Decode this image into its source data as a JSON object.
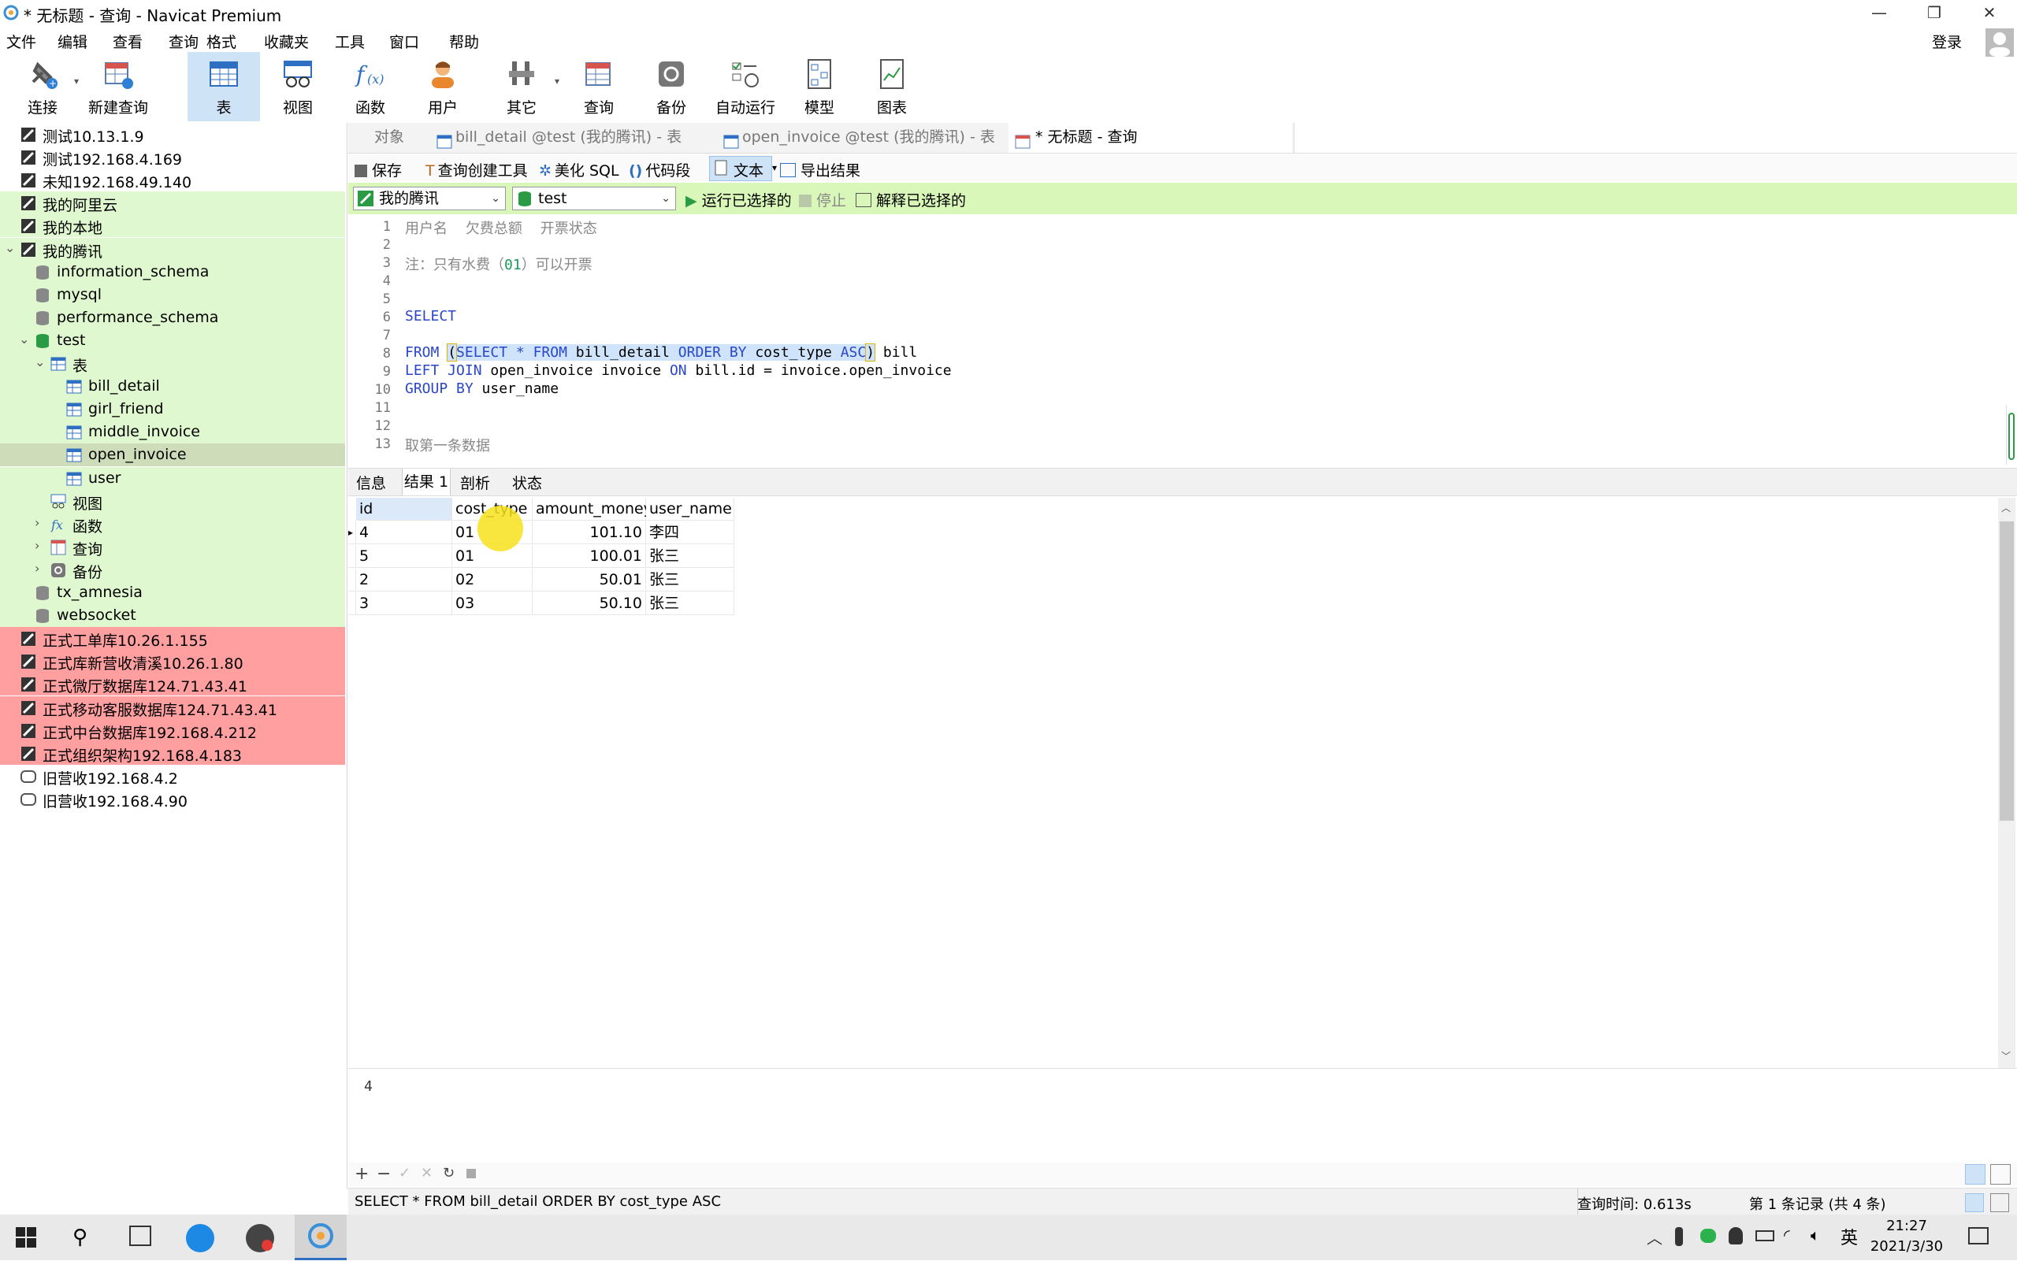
{
  "window": {
    "title": "* 无标题 - 查询 - Navicat Premium",
    "controls": [
      "—",
      "❐",
      "✕"
    ]
  },
  "menu": [
    "文件",
    "编辑",
    "查看",
    "查询",
    "格式",
    "收藏夹",
    "工具",
    "窗口",
    "帮助"
  ],
  "login": "登录",
  "toolbar": [
    {
      "label": "连接",
      "icon": "plug-icon"
    },
    {
      "label": "新建查询",
      "icon": "new-query-icon"
    },
    {
      "label": "表",
      "icon": "table-icon",
      "active": true
    },
    {
      "label": "视图",
      "icon": "view-icon"
    },
    {
      "label": "函数",
      "icon": "function-icon"
    },
    {
      "label": "用户",
      "icon": "user-icon"
    },
    {
      "label": "其它",
      "icon": "tools-icon"
    },
    {
      "label": "查询",
      "icon": "query-icon"
    },
    {
      "label": "备份",
      "icon": "backup-icon"
    },
    {
      "label": "自动运行",
      "icon": "autorun-icon"
    },
    {
      "label": "模型",
      "icon": "model-icon"
    },
    {
      "label": "图表",
      "icon": "chart-icon"
    }
  ],
  "tree": [
    {
      "label": "测试10.13.1.9",
      "bg": "",
      "type": "conn"
    },
    {
      "label": "测试192.168.4.169",
      "bg": "",
      "type": "conn"
    },
    {
      "label": "未知192.168.49.140",
      "bg": "",
      "type": "conn"
    },
    {
      "label": "我的阿里云",
      "bg": "g",
      "type": "conn"
    },
    {
      "label": "我的本地",
      "bg": "g",
      "type": "conn"
    },
    {
      "label": "我的腾讯",
      "bg": "g",
      "type": "conn-open"
    },
    {
      "label": "information_schema",
      "bg": "g",
      "type": "db"
    },
    {
      "label": "mysql",
      "bg": "g",
      "type": "db"
    },
    {
      "label": "performance_schema",
      "bg": "g",
      "type": "db"
    },
    {
      "label": "test",
      "bg": "g",
      "type": "db-open"
    },
    {
      "label": "表",
      "bg": "g",
      "type": "folder-table"
    },
    {
      "label": "bill_detail",
      "bg": "g",
      "type": "table"
    },
    {
      "label": "girl_friend",
      "bg": "g",
      "type": "table"
    },
    {
      "label": "middle_invoice",
      "bg": "g",
      "type": "table"
    },
    {
      "label": "open_invoice",
      "bg": "sel",
      "type": "table"
    },
    {
      "label": "user",
      "bg": "g",
      "type": "table"
    },
    {
      "label": "视图",
      "bg": "g",
      "type": "folder-view"
    },
    {
      "label": "函数",
      "bg": "g",
      "type": "folder-func"
    },
    {
      "label": "查询",
      "bg": "g",
      "type": "folder-query"
    },
    {
      "label": "备份",
      "bg": "g",
      "type": "folder-backup"
    },
    {
      "label": "tx_amnesia",
      "bg": "g",
      "type": "db"
    },
    {
      "label": "websocket",
      "bg": "g",
      "type": "db"
    },
    {
      "label": "正式工单库10.26.1.155",
      "bg": "r",
      "type": "conn"
    },
    {
      "label": "正式库新营收清溪10.26.1.80",
      "bg": "r",
      "type": "conn"
    },
    {
      "label": "正式微厅数据库124.71.43.41",
      "bg": "r",
      "type": "conn"
    },
    {
      "label": "正式移动客服数据库124.71.43.41",
      "bg": "r",
      "type": "conn"
    },
    {
      "label": "正式中台数据库192.168.4.212",
      "bg": "r",
      "type": "conn"
    },
    {
      "label": "正式组织架构192.168.4.183",
      "bg": "r",
      "type": "conn"
    },
    {
      "label": "旧营收192.168.4.2",
      "bg": "",
      "type": "conn-grey"
    },
    {
      "label": "旧营收192.168.4.90",
      "bg": "",
      "type": "conn-grey"
    }
  ],
  "tabs": [
    "对象",
    "bill_detail @test (我的腾讯) - 表",
    "open_invoice @test (我的腾讯) - 表",
    "* 无标题 - 查询"
  ],
  "qtools": [
    "保存",
    "查询创建工具",
    "美化 SQL",
    "代码段",
    "文本",
    "导出结果"
  ],
  "runbar": {
    "connection": "我的腾讯",
    "database": "test",
    "run": "运行已选择的",
    "stop": "停止",
    "explain": "解释已选择的"
  },
  "editor_lines": [
    {
      "n": "1",
      "segments": [
        {
          "t": "用户名    欠费总额    开票状态",
          "c": "cm"
        }
      ]
    },
    {
      "n": "2",
      "segments": []
    },
    {
      "n": "3",
      "segments": [
        {
          "t": "注：只有水费（",
          "c": "cm"
        },
        {
          "t": "01",
          "c": "num"
        },
        {
          "t": "）可以开票",
          "c": "cm"
        }
      ]
    },
    {
      "n": "4",
      "segments": []
    },
    {
      "n": "5",
      "segments": []
    },
    {
      "n": "6",
      "segments": [
        {
          "t": "SELECT",
          "c": "kw"
        }
      ]
    },
    {
      "n": "7",
      "segments": []
    },
    {
      "n": "8",
      "segments": [
        {
          "t": "FROM ",
          "c": "kw"
        },
        {
          "t": "(",
          "c": "hlp"
        },
        {
          "t": "SELECT * FROM ",
          "c": "kwhl"
        },
        {
          "t": "bill_detail ",
          "c": "hl"
        },
        {
          "t": "ORDER BY ",
          "c": "kwhl"
        },
        {
          "t": "cost_type ",
          "c": "hl"
        },
        {
          "t": "ASC",
          "c": "kwhl"
        },
        {
          "t": ")",
          "c": "hlp"
        },
        {
          "t": " bill",
          "c": ""
        }
      ]
    },
    {
      "n": "9",
      "segments": [
        {
          "t": "LEFT JOIN ",
          "c": "kw"
        },
        {
          "t": "open_invoice invoice ",
          "c": ""
        },
        {
          "t": "ON ",
          "c": "kw"
        },
        {
          "t": "bill.id = invoice.open_invoice",
          "c": ""
        }
      ]
    },
    {
      "n": "10",
      "segments": [
        {
          "t": "GROUP BY ",
          "c": "kw"
        },
        {
          "t": "user_name",
          "c": ""
        }
      ]
    },
    {
      "n": "11",
      "segments": []
    },
    {
      "n": "12",
      "segments": []
    },
    {
      "n": "13",
      "segments": [
        {
          "t": "取第一条数据",
          "c": "cm"
        }
      ]
    }
  ],
  "result_tabs": [
    "信息",
    "结果 1",
    "剖析",
    "状态"
  ],
  "grid": {
    "columns": [
      "id",
      "cost_type",
      "amount_money",
      "user_name"
    ],
    "rows": [
      [
        "4",
        "01",
        "101.10",
        "李四"
      ],
      [
        "5",
        "01",
        "100.01",
        "张三"
      ],
      [
        "2",
        "02",
        "50.01",
        "张三"
      ],
      [
        "3",
        "03",
        "50.10",
        "张三"
      ]
    ]
  },
  "cell_value": "4",
  "status": {
    "sql": "SELECT * FROM bill_detail ORDER BY cost_type ASC",
    "time": "查询时间: 0.613s",
    "records": "第 1 条记录 (共 4 条)"
  },
  "taskbar": {
    "time": "21:27",
    "date": "2021/3/30",
    "ime": "英"
  },
  "colors": {
    "green_bg": "#e0f8cf",
    "red_bg": "#ff9f9f",
    "selected": "#cfdcb9",
    "runbar": "#d9f7b8",
    "keyword": "#2a47c9",
    "cursor": "#f7e21c"
  }
}
